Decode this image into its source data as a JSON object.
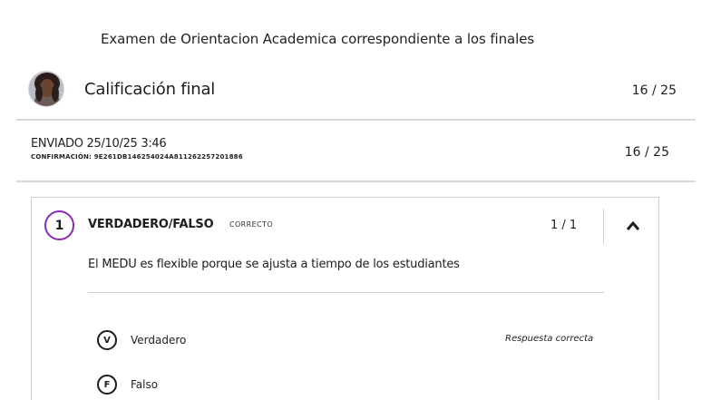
{
  "exam": {
    "title": "Examen de Orientacion Academica correspondiente a los finales"
  },
  "grade": {
    "label": "Calificación final",
    "score": "16 / 25"
  },
  "submission": {
    "sent": "ENVIADO 25/10/25 3:46",
    "confirmation": "CONFIRMACIÓN: 9E261DB146254024A811262257201886",
    "score": "16 / 25"
  },
  "question": {
    "number": "1",
    "type": "VERDADERO/FALSO",
    "status": "CORRECTO",
    "score": "1 / 1",
    "text": "El MEDU es flexible porque se ajusta a tiempo de los estudiantes",
    "options": [
      {
        "letter": "V",
        "label": "Verdadero",
        "note": "Respuesta correcta"
      },
      {
        "letter": "F",
        "label": "Falso"
      }
    ]
  },
  "icons": {
    "collapse": "chevron-up-icon",
    "avatar": "user-avatar"
  },
  "colors": {
    "accent": "#8b28b5",
    "divider": "#d9d9d9"
  }
}
